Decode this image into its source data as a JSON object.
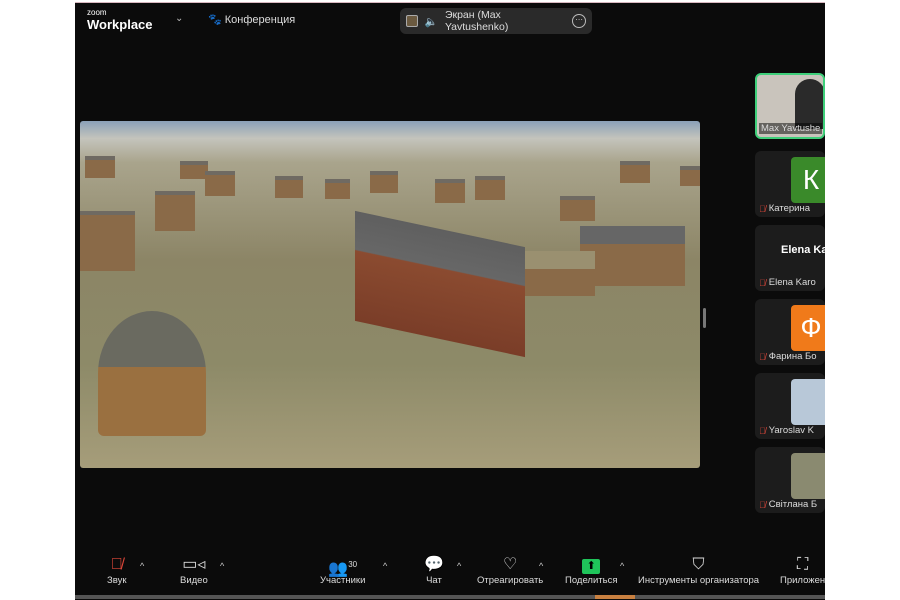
{
  "header": {
    "logo_small": "zoom",
    "logo_big": "Workplace",
    "meeting_label": "Конференция",
    "share_label": "Экран (Max Yavtushenko)"
  },
  "participants": [
    {
      "name": "Max Yavtushe",
      "avatar": "",
      "color": "#c9c4bc",
      "muted": false,
      "active": true
    },
    {
      "name": "Катерина",
      "avatar": "К",
      "color": "#3a8a2a",
      "muted": true
    },
    {
      "name": "Elena Karo",
      "avatar": "Elena Ka",
      "color": "#1c1c1c",
      "muted": true
    },
    {
      "name": "Фарина Бо",
      "avatar": "Ф",
      "color": "#f07a1a",
      "muted": true
    },
    {
      "name": "Yaroslav K",
      "avatar": "",
      "color": "#b8c8d8",
      "muted": true
    },
    {
      "name": "Світлана Б",
      "avatar": "",
      "color": "#8a8a70",
      "muted": true
    }
  ],
  "toolbar": {
    "audio": "Звук",
    "video": "Видео",
    "participants": "Участники",
    "participants_count": "30",
    "chat": "Чат",
    "react": "Отреагировать",
    "share": "Поделиться",
    "host_tools": "Инструменты организатора",
    "apps": "Приложен"
  },
  "colors": {
    "share_green": "#1fc45a",
    "active_border": "#3ecf7a"
  }
}
